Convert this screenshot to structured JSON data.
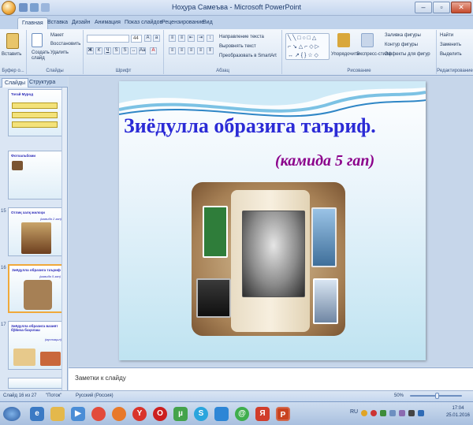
{
  "window": {
    "title": "Ноҳура Самеъва - Microsoft PowerPoint"
  },
  "tabs": [
    "Главная",
    "Вставка",
    "Дизайн",
    "Анимация",
    "Показ слайдов",
    "Рецензирование",
    "Вид"
  ],
  "ribbon": {
    "clipboard": {
      "paste": "Вставить",
      "create_slide": "Создать слайд",
      "layout": "Макет",
      "restore": "Восстановить",
      "delete": "Удалить",
      "label": "Буфер о...",
      "slides_label": "Слайды"
    },
    "font_label": "Шрифт",
    "font_size": "44",
    "paragraph": {
      "text_direction": "Направление текста",
      "align_text": "Выровнять текст",
      "smartart": "Преобразовать в SmartArt",
      "label": "Абзац"
    },
    "drawing": {
      "arrange": "Упорядочить",
      "quick_styles": "Экспресс-стили",
      "fill": "Заливка фигуры",
      "outline": "Контур фигуры",
      "effects": "Эффекты для фигур",
      "label": "Рисование"
    },
    "editing": {
      "find": "Найти",
      "replace": "Заменить",
      "select": "Выделить",
      "label": "Редактирование"
    }
  },
  "left_pane": {
    "tabs": [
      "Слайды",
      "Структура"
    ],
    "thumbs": [
      {
        "num": "",
        "title": "Тоғай Мурод",
        "sub": ""
      },
      {
        "num": "",
        "title": "Фотоальбоми",
        "sub": ""
      },
      {
        "num": "15",
        "title": "Отлиқ халқ жилоҳи",
        "sub": "(камида 2 гап)"
      },
      {
        "num": "16",
        "title": "Зиёдулла образига таъриф",
        "sub": "(камида 5 гап)"
      },
      {
        "num": "17",
        "title": "Зиёдулла образига вазият бўйича баҳолаш",
        "sub": "(мустақил)"
      }
    ]
  },
  "slide": {
    "title": "Зиёдулла образига таъриф.",
    "subtitle": "(камида 5 гап)"
  },
  "notes": {
    "placeholder": "Заметки к слайду"
  },
  "status": {
    "slide": "Слайд 16 из 27",
    "theme": "\"Поток\"",
    "language": "Русский (Россия)",
    "zoom": "50%"
  },
  "taskbar": {
    "lang": "RU",
    "time": "17:04",
    "date": "25.01.2016"
  }
}
